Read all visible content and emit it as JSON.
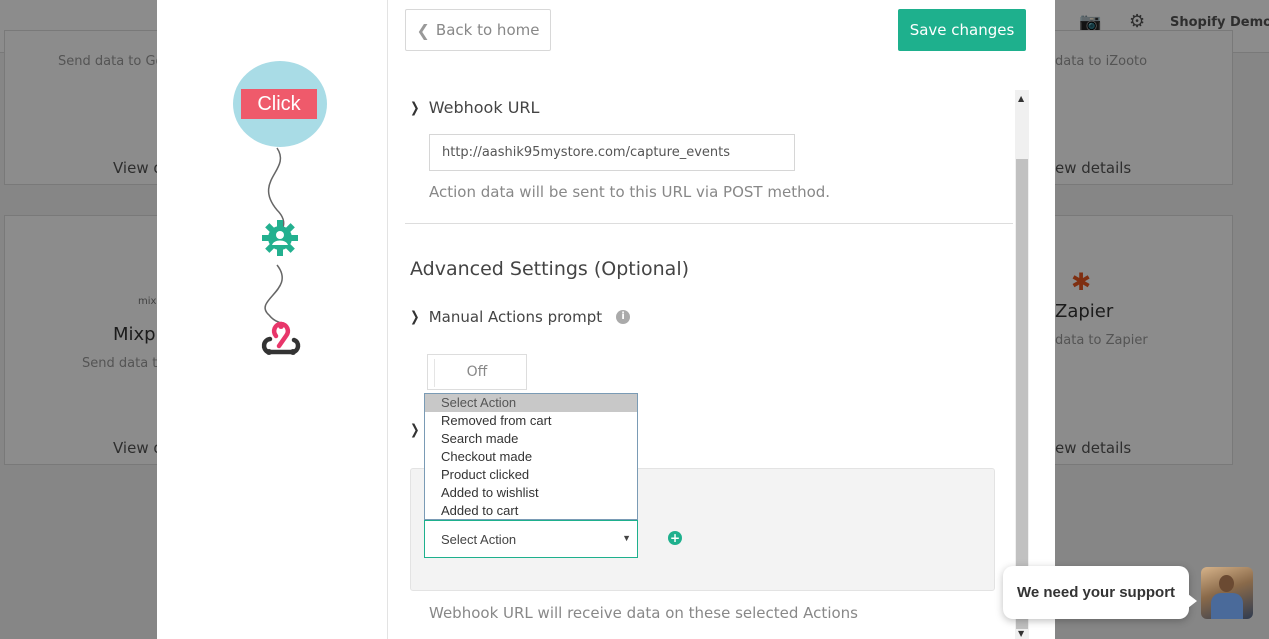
{
  "background": {
    "store_name": "Shopify Demo",
    "cards": [
      {
        "subtitle": "Send data to Go",
        "link": "View d"
      },
      {
        "subtitle": "data to iZooto",
        "link": "ew details"
      },
      {
        "title": "Mixp",
        "subtitle": "Send data t",
        "link": "View d",
        "logo_text": "mixp"
      },
      {
        "title": "Zapier",
        "subtitle": "data to Zapier",
        "link": "ew details"
      }
    ]
  },
  "flow": {
    "trigger_label": "Click"
  },
  "toolbar": {
    "back_label": "Back to home",
    "save_label": "Save changes"
  },
  "webhook": {
    "section_title": "Webhook URL",
    "url_value": "http://aashik95mystore.com/capture_events",
    "help_text": "Action data will be sent to this URL via POST method."
  },
  "advanced": {
    "title": "Advanced Settings (Optional)",
    "manual_prompt_label": "Manual Actions prompt",
    "toggle_value": "Off",
    "select_value": "Select Action",
    "options": [
      "Select Action",
      "Removed from cart",
      "Search made",
      "Checkout made",
      "Product clicked",
      "Added to wishlist",
      "Added to cart"
    ],
    "help_text": "Webhook URL will receive data on these selected Actions"
  },
  "support": {
    "message": "We need your support"
  },
  "colors": {
    "accent": "#1eb08d",
    "click_bg": "#ef5a6b",
    "circle_bg": "#a9dce6",
    "webhook_pink": "#e8366a"
  }
}
